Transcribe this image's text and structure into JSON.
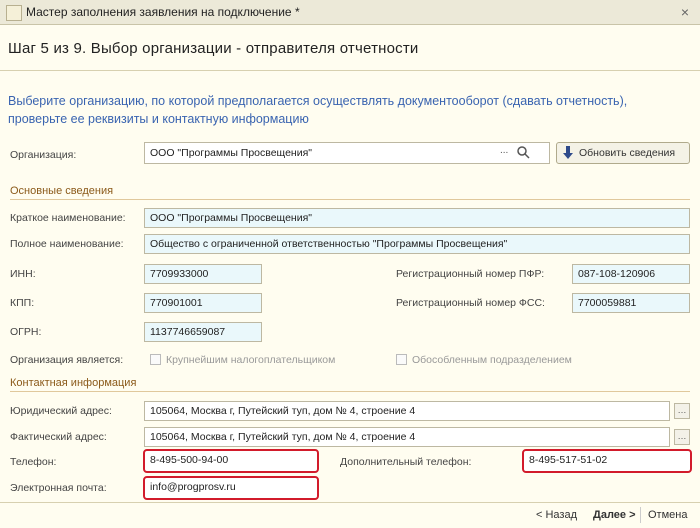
{
  "window": {
    "title": "Мастер заполнения заявления на подключение *",
    "close": "×"
  },
  "step_title": "Шаг 5 из 9. Выбор организации - отправителя отчетности",
  "description": "Выберите организацию, по которой предполагается осуществлять документооборот (сдавать отчетность), проверьте ее реквизиты и контактную информацию",
  "org": {
    "label": "Организация:",
    "value": "ООО \"Программы Просвещения\"",
    "ellipsis": "...",
    "search_icon": "magnifier-icon",
    "update_button": "Обновить сведения"
  },
  "basic": {
    "section": "Основные сведения",
    "short_name_label": "Краткое наименование:",
    "short_name": "ООО \"Программы Просвещения\"",
    "full_name_label": "Полное наименование:",
    "full_name": "Общество с ограниченной ответственностью \"Программы Просвещения\"",
    "inn_label": "ИНН:",
    "inn": "7709933000",
    "kpp_label": "КПП:",
    "kpp": "770901001",
    "ogrn_label": "ОГРН:",
    "ogrn": "1137746659087",
    "pfr_label": "Регистрационный номер ПФР:",
    "pfr": "087-108-120906",
    "fss_label": "Регистрационный номер ФСС:",
    "fss": "7700059881",
    "is_label": "Организация является:",
    "largest_taxpayer": "Крупнейшим налогоплательщиком",
    "separate_division": "Обособленным подразделением"
  },
  "contacts": {
    "section": "Контактная информация",
    "legal_address_label": "Юридический адрес:",
    "legal_address": "105064, Москва г, Путейский туп, дом № 4, строение 4",
    "actual_address_label": "Фактический адрес:",
    "actual_address": "105064, Москва г, Путейский туп, дом № 4, строение 4",
    "phone_label": "Телефон:",
    "phone": "8-495-500-94-00",
    "extra_phone_label": "Дополнительный телефон:",
    "extra_phone": "8-495-517-51-02",
    "email_label": "Электронная почта:",
    "email": "info@progprosv.ru"
  },
  "footer": {
    "back": "< Назад",
    "next": "Далее >",
    "cancel": "Отмена"
  },
  "colors": {
    "highlight": "#d21b2b",
    "description": "#3a64b0",
    "section": "#8b5a1a"
  }
}
